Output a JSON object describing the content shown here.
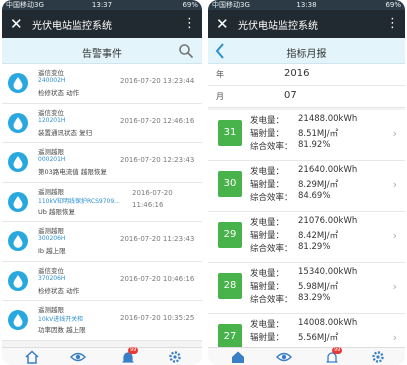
{
  "left": {
    "status": {
      "carrier": "中国移动3G",
      "time": "13:37",
      "battery": "69%"
    },
    "app_title": "光伏电站监控系统",
    "page_title": "告警事件",
    "alarms": [
      {
        "l1": "遥信变位",
        "l2": "240002H",
        "l3": "检修状态 动作",
        "time": "2016-07-20 13:23:44"
      },
      {
        "l1": "遥信变位",
        "l2": "120201H",
        "l3": "装置通讯状态 复归",
        "time": "2016-07-20 12:46:16"
      },
      {
        "l1": "遥测越限",
        "l2": "000201H",
        "l3": "第03路电流值 越限恢复",
        "time": "2016-07-20 12:23:43"
      },
      {
        "l1": "遥测越限",
        "l2": "110kV知明线保护RCS9709...",
        "l3": "Ub 越限恢复",
        "time_date": "2016-07-20",
        "time_clock": "11:46:16"
      },
      {
        "l1": "遥测越限",
        "l2": "300206H",
        "l3": "Ib 越上限",
        "time": "2016-07-20 11:23:43"
      },
      {
        "l1": "遥信变位",
        "l2": "370206H",
        "l3": "检修状态 动作",
        "time": "2016-07-20 10:46:16"
      },
      {
        "l1": "遥测越限",
        "l2": "10kV进线开关柜",
        "l3": "功率因数 越上限",
        "time": "2016-07-20 10:35:25"
      }
    ],
    "badge": "99"
  },
  "right": {
    "status": {
      "carrier": "中国移动3G",
      "time": "13:38",
      "battery": "69%"
    },
    "app_title": "光伏电站监控系统",
    "page_title": "指标月报",
    "year_label": "年",
    "year_value": "2016",
    "month_label": "月",
    "month_value": "07",
    "labels": {
      "gen": "发电量：",
      "rad": "辐射量：",
      "eff": "综合效率："
    },
    "reports": [
      {
        "day": "31",
        "gen": "21488.00kWh",
        "rad": "8.51MJ/㎡",
        "eff": "81.92%"
      },
      {
        "day": "30",
        "gen": "21640.00kWh",
        "rad": "8.29MJ/㎡",
        "eff": "84.69%"
      },
      {
        "day": "29",
        "gen": "21076.00kWh",
        "rad": "8.42MJ/㎡",
        "eff": "81.29%"
      },
      {
        "day": "28",
        "gen": "15340.00kWh",
        "rad": "5.98MJ/㎡",
        "eff": "83.29%"
      },
      {
        "day": "27",
        "gen": "14008.00kWh",
        "rad": "5.56MJ/㎡",
        "eff": ""
      }
    ],
    "badge": "99"
  },
  "colors": {
    "appbar": "#222a31",
    "subbar": "#e3f4fb",
    "accent": "#29a8e0",
    "green": "#47b34a",
    "badge": "#e53935"
  }
}
